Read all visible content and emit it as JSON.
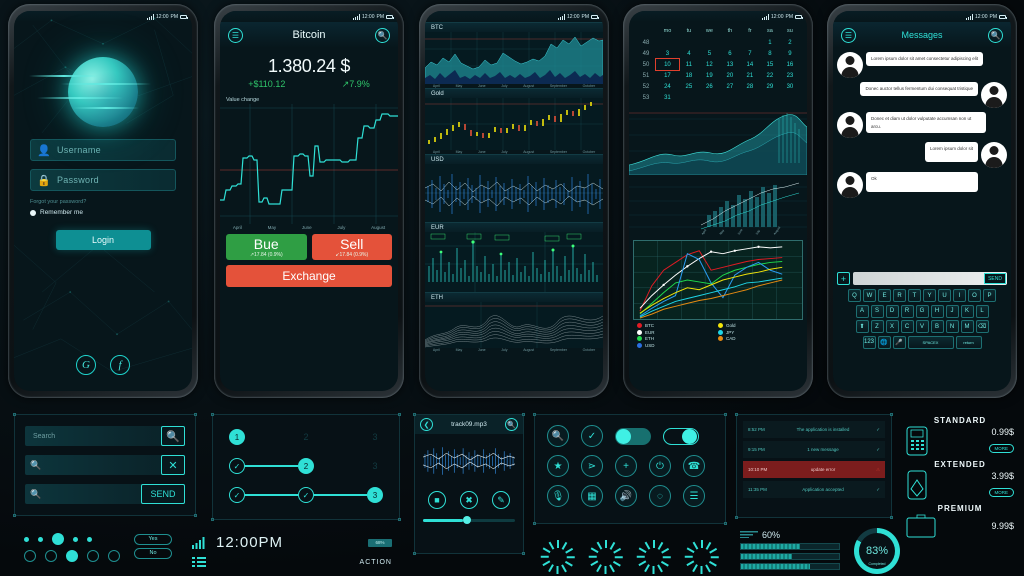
{
  "statusbar": {
    "time": "12:00",
    "ampm": "PM"
  },
  "phone_login": {
    "username_placeholder": "Username",
    "password_placeholder": "Password",
    "forgot_label": "Forgot your password?",
    "remember_label": "Remember me",
    "login_label": "Login",
    "social": [
      {
        "name": "google",
        "glyph": "G"
      },
      {
        "name": "facebook",
        "glyph": "f"
      }
    ]
  },
  "phone_bitcoin": {
    "title": "Bitcoin",
    "price": "1.380.24 $",
    "change_abs": "+$110.12",
    "change_pct": "↗7.9%",
    "chart_caption": "Value change",
    "months": [
      "April",
      "May",
      "June",
      "July",
      "August"
    ],
    "buy": {
      "label": "Bue",
      "delta": "↗17.84 (0.9%)"
    },
    "sell": {
      "label": "Sell",
      "delta": "↙17.84 (0.9%)"
    },
    "exchange_label": "Exchange",
    "colors": {
      "buy": "#2f9e44",
      "sell": "#e4523a",
      "accent": "#2fe0d6"
    }
  },
  "phone_multichart": {
    "charts": [
      {
        "label": "BTC",
        "months": [
          "April",
          "May",
          "June",
          "July",
          "August",
          "September",
          "October"
        ]
      },
      {
        "label": "Gold",
        "months": [
          "April",
          "May",
          "June",
          "July",
          "August",
          "September",
          "October"
        ]
      },
      {
        "label": "USD",
        "months": []
      },
      {
        "label": "EUR",
        "months": []
      },
      {
        "label": "ETH",
        "months": [
          "April",
          "May",
          "June",
          "July",
          "August",
          "September",
          "October"
        ]
      }
    ]
  },
  "phone_calendar": {
    "weekdays": [
      "mo",
      "tu",
      "we",
      "th",
      "fr",
      "sa",
      "su"
    ],
    "weeks": [
      {
        "wk": "48",
        "days": [
          "",
          "",
          "",
          "",
          "",
          "1",
          "2"
        ]
      },
      {
        "wk": "49",
        "days": [
          "3",
          "4",
          "5",
          "6",
          "7",
          "8",
          "9"
        ]
      },
      {
        "wk": "50",
        "days": [
          "10",
          "11",
          "12",
          "13",
          "14",
          "15",
          "16"
        ]
      },
      {
        "wk": "51",
        "days": [
          "17",
          "18",
          "19",
          "20",
          "21",
          "22",
          "23"
        ]
      },
      {
        "wk": "52",
        "days": [
          "24",
          "25",
          "26",
          "27",
          "28",
          "29",
          "30"
        ]
      },
      {
        "wk": "53",
        "days": [
          "31",
          "",
          "",
          "",
          "",
          "",
          ""
        ]
      }
    ],
    "selected_day": "10",
    "legend": [
      {
        "label": "BTC",
        "color": "#e01b24"
      },
      {
        "label": "EUR",
        "color": "#ffffff"
      },
      {
        "label": "ETH",
        "color": "#1fd94c"
      },
      {
        "label": "USD",
        "color": "#2a6fe0"
      },
      {
        "label": "Gold",
        "color": "#f2e40a"
      },
      {
        "label": "JPY",
        "color": "#1fd6e8"
      },
      {
        "label": "CAD",
        "color": "#e58a12"
      }
    ]
  },
  "phone_messages": {
    "title": "Messages",
    "bubbles": [
      {
        "side": "left",
        "text": "Lorem ipsum dolor sit amet consectetur adipiscing elit"
      },
      {
        "side": "right",
        "text": "Donec auctor tellus fermentum dui consequat tristique"
      },
      {
        "side": "left",
        "text": "Donec et diam ut dolor vulputate accumsan non ut arcu."
      },
      {
        "side": "right",
        "text": "Lorem ipsum dolor sit"
      },
      {
        "side": "left",
        "text": "Ok"
      }
    ],
    "send_label": "SEND",
    "keyboard": {
      "row1": [
        "Q",
        "W",
        "E",
        "R",
        "T",
        "Y",
        "U",
        "I",
        "O",
        "P"
      ],
      "row2": [
        "A",
        "S",
        "D",
        "R",
        "G",
        "H",
        "J",
        "K",
        "L"
      ],
      "row3": [
        "⬆",
        "Z",
        "X",
        "C",
        "V",
        "B",
        "N",
        "M",
        "⌫"
      ],
      "row4": [
        "123",
        "🌐",
        "🎤",
        "SPACEX",
        "return"
      ]
    }
  },
  "kit_search": {
    "fields": [
      {
        "name": "search-field-1",
        "label": "Search",
        "button": "magnify",
        "button_label": ""
      },
      {
        "name": "search-field-2",
        "label": "",
        "button": "close",
        "button_label": "✕"
      },
      {
        "name": "search-field-3",
        "label": "",
        "button": "send",
        "button_label": "SEND"
      }
    ],
    "yes_label": "Yes",
    "no_label": "No"
  },
  "kit_stepper": {
    "rows": [
      {
        "nodes": [
          "1",
          "2",
          "3"
        ],
        "active": 1
      },
      {
        "nodes": [
          "✓",
          "2",
          "3"
        ],
        "active": 2
      },
      {
        "nodes": [
          "✓",
          "✓",
          "3"
        ],
        "active": 3
      }
    ],
    "time": "12:00PM",
    "battery": "68%",
    "action_label": "ACTION"
  },
  "kit_player": {
    "track": "track09.mp3",
    "buttons": [
      "stop",
      "shuffle",
      "edit"
    ],
    "progress_pct": 44
  },
  "kit_icons": {
    "row1": [
      "search-icon",
      "check-icon"
    ],
    "toggles": [
      {
        "state": "on-filled"
      },
      {
        "state": "on-outline"
      }
    ],
    "row2": [
      "star-icon",
      "share-icon",
      "plus-icon",
      "power-icon",
      "phone-icon"
    ],
    "row3": [
      "mic-icon",
      "grid-icon",
      "speaker-icon",
      "circle-icon",
      "list-icon"
    ]
  },
  "kit_notifications": [
    {
      "time": "8:52 PM",
      "text": "The application is installed",
      "state": "ok"
    },
    {
      "time": "9:15 PM",
      "text": "1 new message",
      "state": "ok"
    },
    {
      "time": "10:10 PM",
      "text": "update error",
      "state": "error"
    },
    {
      "time": "11:35 PM",
      "text": "Application accepted",
      "state": "ok"
    }
  ],
  "kit_pricing": [
    {
      "name": "STANDARD",
      "price": "0.99$",
      "more": "MORE",
      "icon": "feature-phone-icon"
    },
    {
      "name": "EXTENDED",
      "price": "3.99$",
      "more": "MORE",
      "icon": "smartphone-icon"
    },
    {
      "name": "PREMIUM",
      "price": "9.99$",
      "more": "MORE",
      "icon": "tablet-icon"
    }
  ],
  "kit_progress": {
    "percent_label": "60%",
    "bars": [
      60,
      52,
      70
    ],
    "gauge_value": "83%",
    "gauge_caption": "Completed"
  },
  "chart_data": [
    {
      "type": "line",
      "name": "bitcoin-value-change",
      "title": "Value change",
      "xlabel": "",
      "ylabel": "",
      "categories": [
        "April",
        "May",
        "June",
        "July",
        "August"
      ],
      "x": [
        0,
        3,
        6,
        9,
        12,
        15,
        18,
        21,
        24,
        27,
        30,
        33,
        36,
        39,
        42,
        45,
        48,
        51,
        54,
        57,
        60,
        63,
        66,
        69,
        72,
        75,
        78,
        81,
        84,
        87,
        90,
        93,
        96,
        99
      ],
      "values": [
        18,
        22,
        26,
        25,
        30,
        31,
        48,
        46,
        44,
        24,
        12,
        13,
        11,
        12,
        28,
        29,
        30,
        56,
        57,
        54,
        33,
        58,
        49,
        50,
        52,
        51,
        53,
        55,
        57,
        60,
        86,
        84,
        88,
        92
      ],
      "ylim": [
        0,
        100
      ],
      "grid": true,
      "series_color": "#2fe0d6"
    },
    {
      "type": "area",
      "name": "btc-mini",
      "title": "BTC",
      "categories": [
        "April",
        "May",
        "June",
        "July",
        "August",
        "September",
        "October"
      ],
      "values": [
        38,
        46,
        40,
        52,
        44,
        60,
        42,
        36,
        30,
        34,
        46,
        38,
        42,
        56,
        50,
        46,
        40,
        44,
        52,
        48,
        58,
        78,
        72,
        86,
        80,
        92
      ],
      "ylim": [
        0,
        100
      ],
      "series_color": "#2aa5ad"
    },
    {
      "type": "candlestick",
      "name": "gold-mini",
      "title": "Gold",
      "categories": [
        "April",
        "May",
        "June",
        "July",
        "August",
        "September",
        "October"
      ],
      "values": [
        12,
        16,
        22,
        30,
        36,
        42,
        38,
        46,
        40,
        34,
        30,
        36,
        42,
        38,
        44,
        48,
        42,
        50,
        56,
        52,
        60,
        66,
        62,
        70,
        76,
        84,
        90
      ],
      "ylim": [
        0,
        100
      ],
      "up_color": "#f2e40a",
      "down_color": "#e4523a"
    },
    {
      "type": "line",
      "name": "usd-waveform",
      "title": "USD",
      "values": [],
      "series_color": "#2a6fe0"
    },
    {
      "type": "area",
      "name": "eur-spectrum",
      "title": "EUR",
      "values": [],
      "series_color": "#2fe0d6"
    },
    {
      "type": "area",
      "name": "eth-ridgeline",
      "title": "ETH",
      "categories": [
        "April",
        "May",
        "June",
        "July",
        "August",
        "September",
        "October"
      ],
      "values": [],
      "series_color": "#d8dee0"
    },
    {
      "type": "line",
      "name": "currencies-comparison",
      "title": "",
      "xlabel": "",
      "ylabel": "",
      "x": [
        1,
        2,
        3,
        4,
        5,
        6,
        7,
        8,
        9,
        10,
        11,
        12,
        13
      ],
      "series": [
        {
          "name": "BTC",
          "color": "#e01b24",
          "values": [
            10,
            45,
            62,
            72,
            82,
            88,
            62,
            66,
            70,
            74,
            76,
            78,
            79
          ]
        },
        {
          "name": "EUR",
          "color": "#ffffff",
          "values": [
            14,
            30,
            44,
            56,
            68,
            78,
            86,
            84,
            88,
            90,
            92,
            91,
            92
          ]
        },
        {
          "name": "ETH",
          "color": "#1fd94c",
          "values": [
            6,
            20,
            34,
            46,
            50,
            48,
            46,
            56,
            62,
            66,
            70,
            72,
            74
          ]
        },
        {
          "name": "USD",
          "color": "#2a6fe0",
          "values": [
            4,
            14,
            22,
            30,
            84,
            76,
            46,
            28,
            56,
            66,
            72,
            62,
            58
          ]
        },
        {
          "name": "Gold",
          "color": "#f2e40a",
          "values": [
            8,
            18,
            26,
            34,
            40,
            38,
            44,
            50,
            54,
            58,
            60,
            64,
            66
          ]
        },
        {
          "name": "JPY",
          "color": "#1fd6e8",
          "values": [
            3,
            10,
            16,
            22,
            26,
            30,
            34,
            38,
            42,
            46,
            48,
            50,
            52
          ]
        },
        {
          "name": "CAD",
          "color": "#e58a12",
          "values": [
            2,
            6,
            12,
            16,
            20,
            24,
            26,
            30,
            34,
            38,
            42,
            46,
            50
          ]
        }
      ],
      "ylim": [
        0,
        100
      ],
      "grid": true,
      "legend_position": "bottom"
    }
  ]
}
